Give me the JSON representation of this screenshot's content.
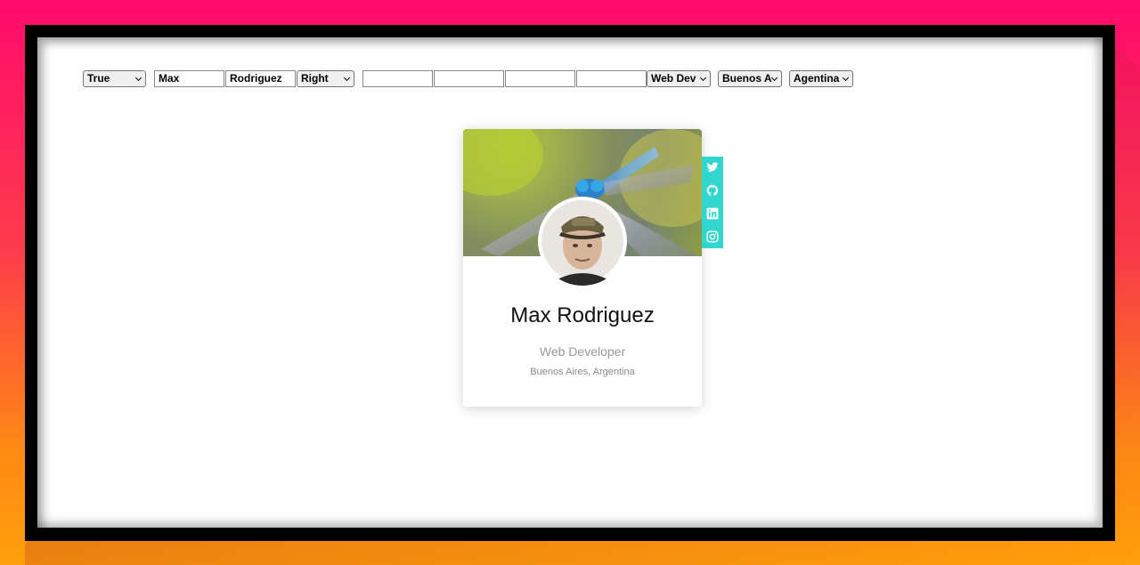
{
  "controls": {
    "flag_select": "True",
    "first_name": "Max",
    "last_name": "Rodriguez",
    "position_select": "Right",
    "link_inputs": [
      "",
      "",
      "",
      ""
    ],
    "role_select": "Web Dev",
    "city_select": "Buenos A",
    "country_select": "Agentina"
  },
  "card": {
    "name": "Max Rodriguez",
    "role": "Web Developer",
    "location": "Buenos Aires, Argentina",
    "social": [
      "twitter-icon",
      "github-icon",
      "linkedin-icon",
      "instagram-icon"
    ]
  },
  "colors": {
    "background_top": "#ff0a6c",
    "background_bottom": "#ff9f0a",
    "social_bar": "#31d6cf"
  }
}
